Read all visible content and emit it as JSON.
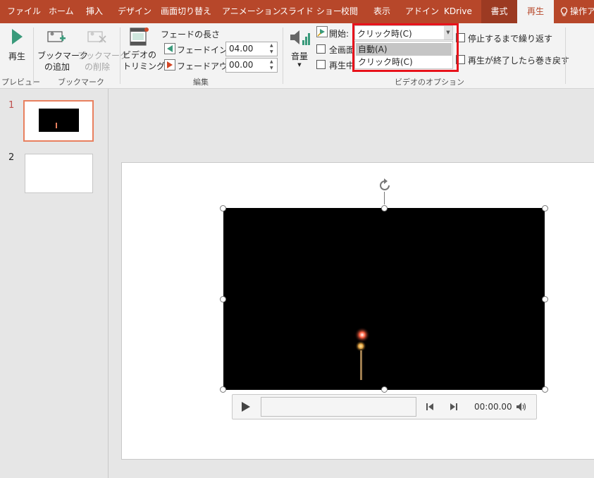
{
  "tabs": [
    "ファイル",
    "ホーム",
    "挿入",
    "デザイン",
    "画面切り替え",
    "アニメーション",
    "スライド ショー",
    "校閲",
    "表示",
    "アドイン",
    "KDrive",
    "書式",
    "再生",
    "操作ア"
  ],
  "ribbon": {
    "preview": {
      "play_label": "再生",
      "group": "プレビュー"
    },
    "bookmark": {
      "add_line1": "ブックマーク",
      "add_line2": "の追加",
      "remove_line1": "ブックマーク",
      "remove_line2": "の削除",
      "group": "ブックマーク"
    },
    "edit": {
      "trim_line1": "ビデオの",
      "trim_line2": "トリミング",
      "fade_title": "フェードの長さ",
      "fade_in_label": "フェードイン:",
      "fade_in_value": "04.00",
      "fade_out_label": "フェードアウト:",
      "fade_out_value": "00.00",
      "group": "編集"
    },
    "video_options": {
      "volume_label": "音量",
      "start_label": "開始:",
      "start_value": "クリック時(C)",
      "fullscreen_label": "全画面",
      "hide_label": "再生中",
      "loop_label": "停止するまで繰り返す",
      "rewind_label": "再生が終了したら巻き戻す",
      "group": "ビデオのオプション",
      "options": [
        "自動(A)",
        "クリック時(C)"
      ]
    }
  },
  "slides": {
    "numbers": [
      "1",
      "2"
    ]
  },
  "player": {
    "time": "00:00.00"
  }
}
